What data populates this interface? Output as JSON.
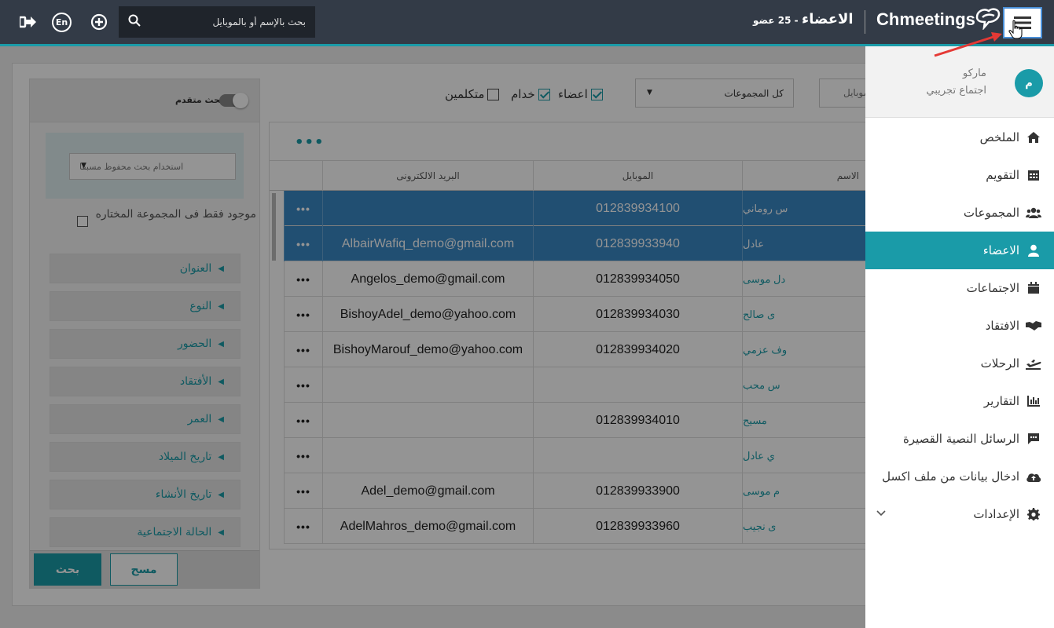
{
  "topbar": {
    "search_placeholder": "بحث بالإسم أو بالموبايل",
    "lang_label": "En",
    "count_text": "- 25 عضو",
    "page_title": "الاعضاء",
    "brand": "Chmeetings"
  },
  "filters": {
    "mobile_field": "موبايل",
    "group_select": "كل المجموعات",
    "types": [
      {
        "label": "اعضاء",
        "checked": true
      },
      {
        "label": "خدام",
        "checked": true
      },
      {
        "label": "متكلمين",
        "checked": false
      }
    ]
  },
  "advanced": {
    "toggle_label": "بحث متقدم",
    "saved_search_placeholder": "استخدام بحث محفوظ مسبقا",
    "only_selected_group": "موجود فقط فى المجموعة المختاره",
    "sections": [
      "العنوان",
      "النوع",
      "الحضور",
      "الأفتقاد",
      "العمر",
      "تاريخ الميلاد",
      "تاريخ الأنشاء",
      "الحالة الاجتماعية"
    ],
    "search_button": "بحث",
    "clear_button": "مسح"
  },
  "table": {
    "columns": {
      "name": "الاسم",
      "mobile": "الموبايل",
      "email": "البريد الالكترونى"
    },
    "rows": [
      {
        "name": "س روماني",
        "mobile": "012839934100",
        "email": "",
        "selected": true
      },
      {
        "name": "عادل",
        "mobile": "012839933940",
        "email": "AlbairWafiq_demo@gmail.com",
        "selected": true
      },
      {
        "name": "دل موسى",
        "mobile": "012839934050",
        "email": "Angelos_demo@gmail.com",
        "selected": false
      },
      {
        "name": "ى صالح",
        "mobile": "012839934030",
        "email": "BishoyAdel_demo@yahoo.com",
        "selected": false
      },
      {
        "name": "وف عزمي",
        "mobile": "012839934020",
        "email": "BishoyMarouf_demo@yahoo.com",
        "selected": false
      },
      {
        "name": "س محب",
        "mobile": "",
        "email": "",
        "selected": false
      },
      {
        "name": "مسيح",
        "mobile": "012839934010",
        "email": "",
        "selected": false
      },
      {
        "name": "ي عادل",
        "mobile": "",
        "email": "",
        "selected": false
      },
      {
        "name": "م موسى",
        "mobile": "012839933900",
        "email": "Adel_demo@gmail.com",
        "selected": false
      },
      {
        "name": "ى نجيب",
        "mobile": "012839933960",
        "email": "AdelMahros_demo@gmail.com",
        "selected": false
      }
    ],
    "row_menu": "•••"
  },
  "sidemenu": {
    "user": {
      "initial": "م",
      "name": "ماركو",
      "subtitle": "اجتماع تجريبي"
    },
    "items": [
      {
        "label": "الملخص",
        "icon": "home-icon",
        "active": false
      },
      {
        "label": "التقويم",
        "icon": "calendar-grid-icon",
        "active": false
      },
      {
        "label": "المجموعات",
        "icon": "users-group-icon",
        "active": false
      },
      {
        "label": "الاعضاء",
        "icon": "user-icon",
        "active": true
      },
      {
        "label": "الاجتماعات",
        "icon": "calendar-icon",
        "active": false
      },
      {
        "label": "الافتقاد",
        "icon": "handshake-icon",
        "active": false
      },
      {
        "label": "الرحلات",
        "icon": "plane-icon",
        "active": false
      },
      {
        "label": "التقارير",
        "icon": "chart-icon",
        "active": false
      },
      {
        "label": "الرسائل النصية القصيرة",
        "icon": "sms-icon",
        "active": false
      },
      {
        "label": "ادخال بيانات من ملف اكسل",
        "icon": "cloud-upload-icon",
        "active": false
      },
      {
        "label": "الإعدادات",
        "icon": "gear-icon",
        "active": false
      }
    ]
  },
  "colors": {
    "accent": "#1a9ba8",
    "topbar": "#333b47",
    "selected_row": "#3a88c5",
    "annotation": "#e53935"
  }
}
